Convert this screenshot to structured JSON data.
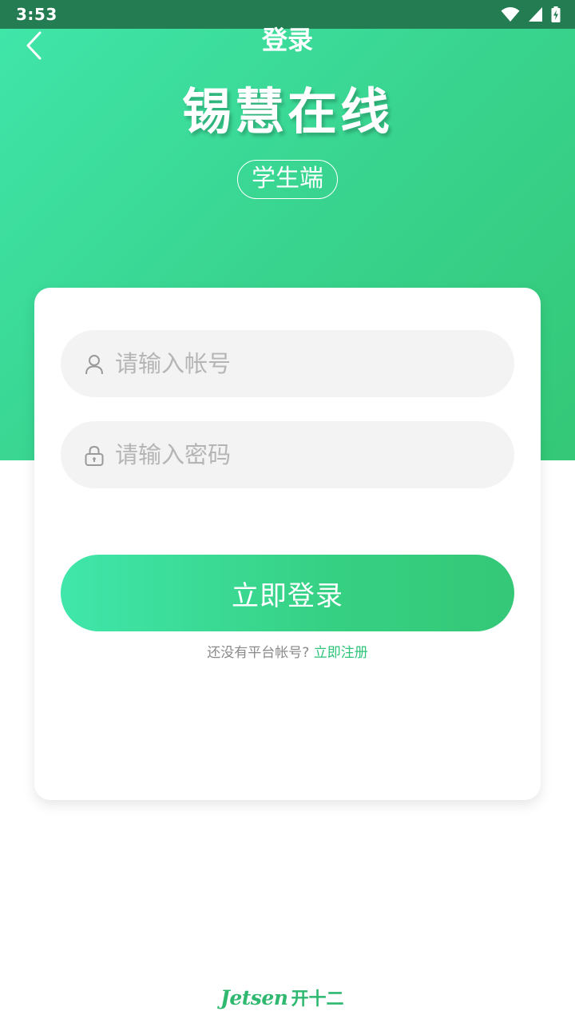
{
  "status_bar": {
    "time": "3:53",
    "icons": [
      "wifi-icon",
      "cell-signal-icon",
      "battery-charging-icon"
    ]
  },
  "nav": {
    "back_icon": "chevron-left-icon",
    "title": "登录"
  },
  "hero": {
    "app_name": "锡慧在线",
    "role_badge": "学生端"
  },
  "login_form": {
    "account_placeholder": "请输入帐号",
    "account_value": "",
    "account_icon": "user-icon",
    "password_placeholder": "请输入密码",
    "password_value": "",
    "password_icon": "lock-icon",
    "submit_label": "立即登录",
    "register_prompt": "还没有平台帐号?",
    "register_link": "立即注册"
  },
  "footer": {
    "logo_en": "Jetsen",
    "logo_cn": "开十二"
  },
  "colors": {
    "accent_start": "#40e6aa",
    "accent_end": "#34c877",
    "status_bar": "#237c52",
    "link": "#2ec47a"
  }
}
